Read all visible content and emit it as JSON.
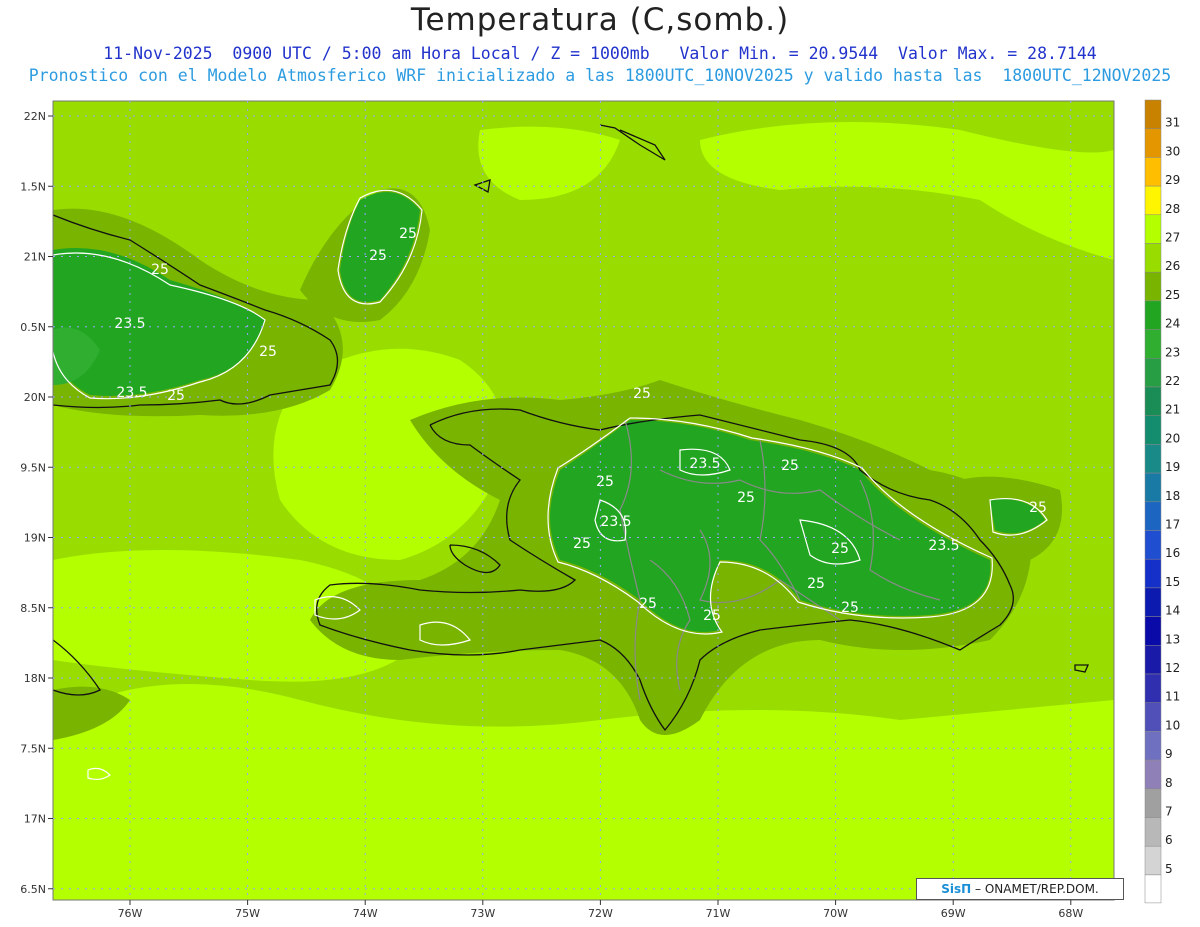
{
  "title": "Temperatura (C,somb.)",
  "subtitle_line1": "11-Nov-2025  0900 UTC / 5:00 am Hora Local / Z = 1000mb   Valor Min. = 20.9544  Valor Max. = 28.7144",
  "subtitle_line2": "Pronostico con el Modelo Atmosferico WRF inicializado a las 1800UTC_10NOV2025 y valido hasta las  1800UTC_12NOV2025",
  "lat_ticks": [
    "22N",
    "1.5N",
    "21N",
    "0.5N",
    "20N",
    "9.5N",
    "19N",
    "8.5N",
    "18N",
    "7.5N",
    "17N",
    "6.5N"
  ],
  "lon_ticks": [
    "76W",
    "75W",
    "74W",
    "73W",
    "72W",
    "71W",
    "70W",
    "69W",
    "68W"
  ],
  "contour_labels": [
    "25",
    "25",
    "25",
    "23.5",
    "25",
    "23.5",
    "25",
    "25",
    "23.5",
    "25",
    "25",
    "25",
    "23.5",
    "25",
    "25",
    "23.5",
    "25",
    "25",
    "25",
    "25",
    "25"
  ],
  "colorbar": {
    "values": [
      "31",
      "30",
      "29",
      "28",
      "27",
      "26",
      "25",
      "24",
      "23",
      "22",
      "21",
      "20",
      "19",
      "18",
      "17",
      "16",
      "15",
      "14",
      "13",
      "12",
      "11",
      "10",
      "9",
      "8",
      "7",
      "6",
      "5"
    ],
    "colors": [
      "#c88200",
      "#e39600",
      "#ffbe00",
      "#fff500",
      "#b4ff00",
      "#99dd00",
      "#78b400",
      "#22a622",
      "#2fae2f",
      "#279e43",
      "#1a8c55",
      "#148c6e",
      "#1a8a88",
      "#1a7aa6",
      "#1c66c2",
      "#1f4ed0",
      "#1530c8",
      "#0d1ab0",
      "#0a0aa8",
      "#1a1aa8",
      "#2f2fb0",
      "#5050b8",
      "#7070c0",
      "#9080b8",
      "#a0a0a0",
      "#b8b8b8",
      "#d4d4d4"
    ]
  },
  "credit": {
    "brand": "SisΠ",
    "text": "– ONAMET/REP.DOM."
  }
}
